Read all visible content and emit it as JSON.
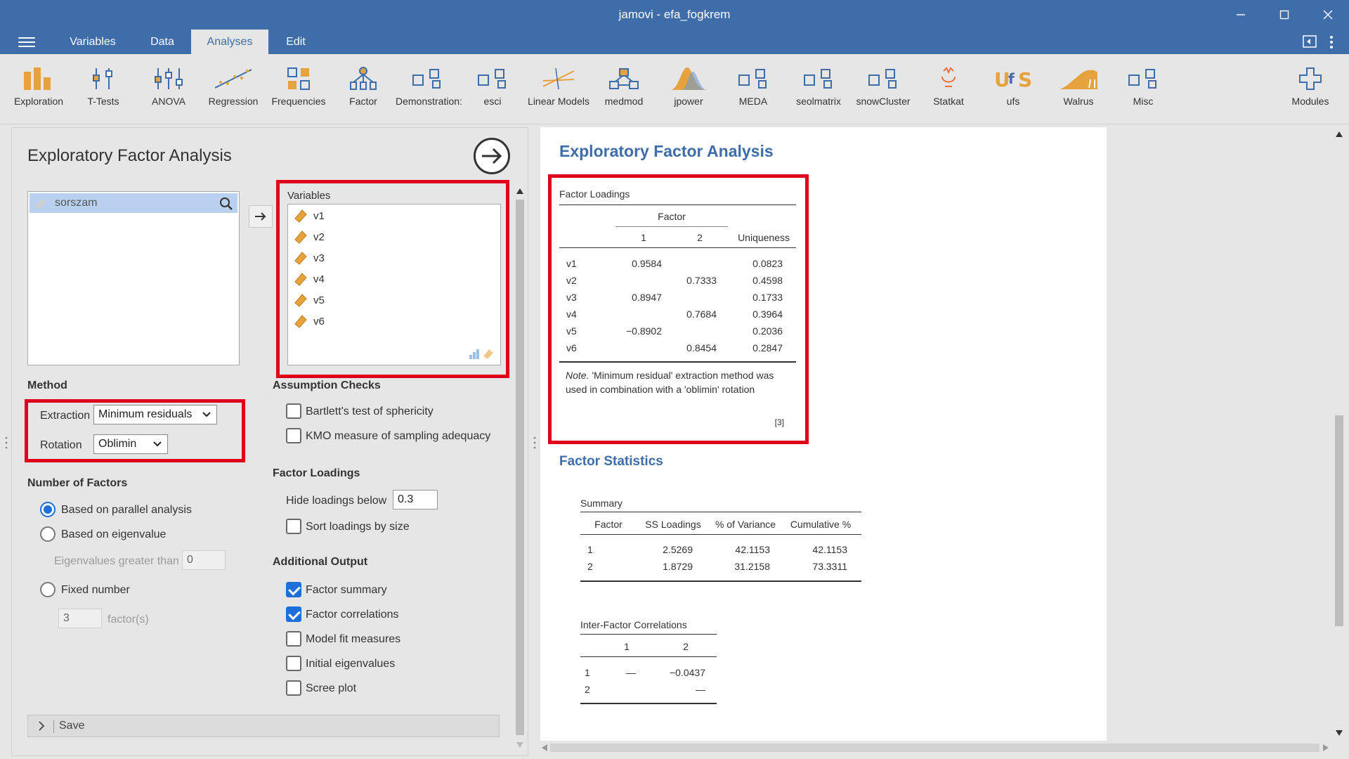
{
  "window": {
    "title": "jamovi - efa_fogkrem"
  },
  "menu": {
    "tabs": [
      "Variables",
      "Data",
      "Analyses",
      "Edit"
    ],
    "active": "Analyses"
  },
  "ribbon": {
    "items": [
      "Exploration",
      "T-Tests",
      "ANOVA",
      "Regression",
      "Frequencies",
      "Factor",
      "Demonstration:",
      "esci",
      "Linear Models",
      "medmod",
      "jpower",
      "MEDA",
      "seolmatrix",
      "snowCluster",
      "Statkat",
      "ufs",
      "Walrus",
      "Misc"
    ],
    "modules": "Modules"
  },
  "options": {
    "title": "Exploratory Factor Analysis",
    "available_variable": "sorszam",
    "variables_label": "Variables",
    "variables": [
      "v1",
      "v2",
      "v3",
      "v4",
      "v5",
      "v6"
    ],
    "method": {
      "heading": "Method",
      "extraction_label": "Extraction",
      "extraction_value": "Minimum residuals",
      "rotation_label": "Rotation",
      "rotation_value": "Oblimin"
    },
    "num_factors": {
      "heading": "Number of Factors",
      "parallel": "Based on parallel analysis",
      "eigenvalue": "Based on eigenvalue",
      "eigen_gt_label": "Eigenvalues greater than",
      "eigen_gt_value": "0",
      "fixed": "Fixed number",
      "fixed_value": "3",
      "fixed_unit": "factor(s)",
      "selected": "parallel"
    },
    "assumption": {
      "heading": "Assumption Checks",
      "bartlett": "Bartlett's test of sphericity",
      "kmo": "KMO measure of sampling adequacy"
    },
    "factor_loadings": {
      "heading": "Factor Loadings",
      "hide_label": "Hide loadings below",
      "hide_value": "0.3",
      "sort": "Sort loadings by size"
    },
    "additional": {
      "heading": "Additional Output",
      "factor_summary": "Factor summary",
      "factor_correlations": "Factor correlations",
      "model_fit": "Model fit measures",
      "initial_eigen": "Initial eigenvalues",
      "scree": "Scree plot"
    },
    "save_label": "Save"
  },
  "results": {
    "title": "Exploratory Factor Analysis",
    "loadings": {
      "title": "Factor Loadings",
      "factor_header": "Factor",
      "col1": "1",
      "col2": "2",
      "col_uniq": "Uniqueness",
      "rows": [
        {
          "var": "v1",
          "f1": "0.9584",
          "f2": "",
          "u": "0.0823"
        },
        {
          "var": "v2",
          "f1": "",
          "f2": "0.7333",
          "u": "0.4598"
        },
        {
          "var": "v3",
          "f1": "0.8947",
          "f2": "",
          "u": "0.1733"
        },
        {
          "var": "v4",
          "f1": "",
          "f2": "0.7684",
          "u": "0.3964"
        },
        {
          "var": "v5",
          "f1": "−0.8902",
          "f2": "",
          "u": "0.2036"
        },
        {
          "var": "v6",
          "f1": "",
          "f2": "0.8454",
          "u": "0.2847"
        }
      ],
      "note_label": "Note.",
      "note_text": "'Minimum residual' extraction method was used in combination with a 'oblimin' rotation",
      "footnote": "[3]"
    },
    "stats_title": "Factor Statistics",
    "summary": {
      "title": "Summary",
      "headers": [
        "Factor",
        "SS Loadings",
        "% of Variance",
        "Cumulative %"
      ],
      "rows": [
        [
          "1",
          "2.5269",
          "42.1153",
          "42.1153"
        ],
        [
          "2",
          "1.8729",
          "31.2158",
          "73.3311"
        ]
      ]
    },
    "correlations": {
      "title": "Inter-Factor Correlations",
      "headers": [
        "1",
        "2"
      ],
      "rows": [
        [
          "1",
          "—",
          "−0.0437"
        ],
        [
          "2",
          "",
          "—"
        ]
      ]
    }
  },
  "colors": {
    "brand": "#3e6da9",
    "highlight": "#e0001b",
    "check": "#1e6fd9",
    "icon": "#e6a23c"
  }
}
